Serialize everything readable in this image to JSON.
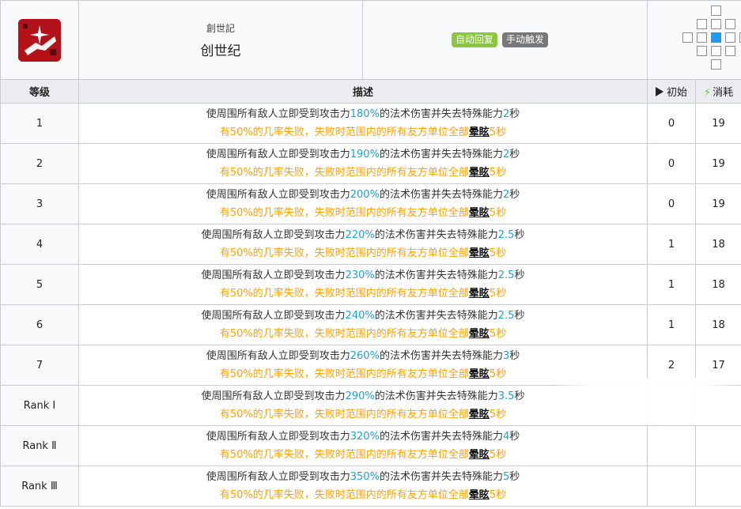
{
  "skill": {
    "name_small": "創世記",
    "name": "创世纪",
    "icon": "skill-genesis-icon",
    "tags": [
      "自动回复",
      "手动触发"
    ],
    "tag_colors": [
      "#8cc63f",
      "#777777"
    ]
  },
  "headers": {
    "level": "等级",
    "description": "描述",
    "initial": "初始",
    "cost": "消耗"
  },
  "rows": [
    {
      "level": "1",
      "pre": "使周围所有敌人立即受到攻击力",
      "atk": "180%",
      "mid": "的法术伤害并失去特殊能力",
      "dur": "2",
      "unit": "秒",
      "l2a": "有50%的几率失败，失败时范围内的所有友方单位全部",
      "stun": "晕眩",
      "l2b": "5秒",
      "initial": "0",
      "cost": "19"
    },
    {
      "level": "2",
      "pre": "使周围所有敌人立即受到攻击力",
      "atk": "190%",
      "mid": "的法术伤害并失去特殊能力",
      "dur": "2",
      "unit": "秒",
      "l2a": "有50%的几率失败，失败时范围内的所有友方单位全部",
      "stun": "晕眩",
      "l2b": "5秒",
      "initial": "0",
      "cost": "19"
    },
    {
      "level": "3",
      "pre": "使周围所有敌人立即受到攻击力",
      "atk": "200%",
      "mid": "的法术伤害并失去特殊能力",
      "dur": "2",
      "unit": "秒",
      "l2a": "有50%的几率失败，失败时范围内的所有友方单位全部",
      "stun": "晕眩",
      "l2b": "5秒",
      "initial": "0",
      "cost": "19"
    },
    {
      "level": "4",
      "pre": "使周围所有敌人立即受到攻击力",
      "atk": "220%",
      "mid": "的法术伤害并失去特殊能力",
      "dur": "2.5",
      "unit": "秒",
      "l2a": "有50%的几率失败，失败时范围内的所有友方单位全部",
      "stun": "晕眩",
      "l2b": "5秒",
      "initial": "1",
      "cost": "18"
    },
    {
      "level": "5",
      "pre": "使周围所有敌人立即受到攻击力",
      "atk": "230%",
      "mid": "的法术伤害并失去特殊能力",
      "dur": "2.5",
      "unit": "秒",
      "l2a": "有50%的几率失败，失败时范围内的所有友方单位全部",
      "stun": "晕眩",
      "l2b": "5秒",
      "initial": "1",
      "cost": "18"
    },
    {
      "level": "6",
      "pre": "使周围所有敌人立即受到攻击力",
      "atk": "240%",
      "mid": "的法术伤害并失去特殊能力",
      "dur": "2.5",
      "unit": "秒",
      "l2a": "有50%的几率失败，失败时范围内的所有友方单位全部",
      "stun": "晕眩",
      "l2b": "5秒",
      "initial": "1",
      "cost": "18"
    },
    {
      "level": "7",
      "pre": "使周围所有敌人立即受到攻击力",
      "atk": "260%",
      "mid": "的法术伤害并失去特殊能力",
      "dur": "3",
      "unit": "秒",
      "l2a": "有50%的几率失败，失败时范围内的所有友方单位全部",
      "stun": "晕眩",
      "l2b": "5秒",
      "initial": "2",
      "cost": "17"
    },
    {
      "level": "Rank Ⅰ",
      "pre": "使周围所有敌人立即受到攻击力",
      "atk": "290%",
      "mid": "的法术伤害并失去特殊能力",
      "dur": "3.5",
      "unit": "秒",
      "l2a": "有50%的几率失败，失败时范围内的所有友方单位全部",
      "stun": "晕眩",
      "l2b": "5秒",
      "initial": "",
      "cost": ""
    },
    {
      "level": "Rank Ⅱ",
      "pre": "使周围所有敌人立即受到攻击力",
      "atk": "320%",
      "mid": "的法术伤害并失去特殊能力",
      "dur": "4",
      "unit": "秒",
      "l2a": "有50%的几率失败，失败时范围内的所有友方单位全部",
      "stun": "晕眩",
      "l2b": "5秒",
      "initial": "",
      "cost": ""
    },
    {
      "level": "Rank Ⅲ",
      "pre": "使周围所有敌人立即受到攻击力",
      "atk": "350%",
      "mid": "的法术伤害并失去特殊能力",
      "dur": "5",
      "unit": "秒",
      "l2a": "有50%的几率失败，失败时范围内的所有友方单位全部",
      "stun": "晕眩",
      "l2b": "5秒",
      "initial": "",
      "cost": ""
    }
  ],
  "colors": {
    "highlight": "#1ba1d7",
    "warning": "#ffa200",
    "range_self": "#1f9bf0",
    "cost_bolt": "#6cc24a"
  }
}
